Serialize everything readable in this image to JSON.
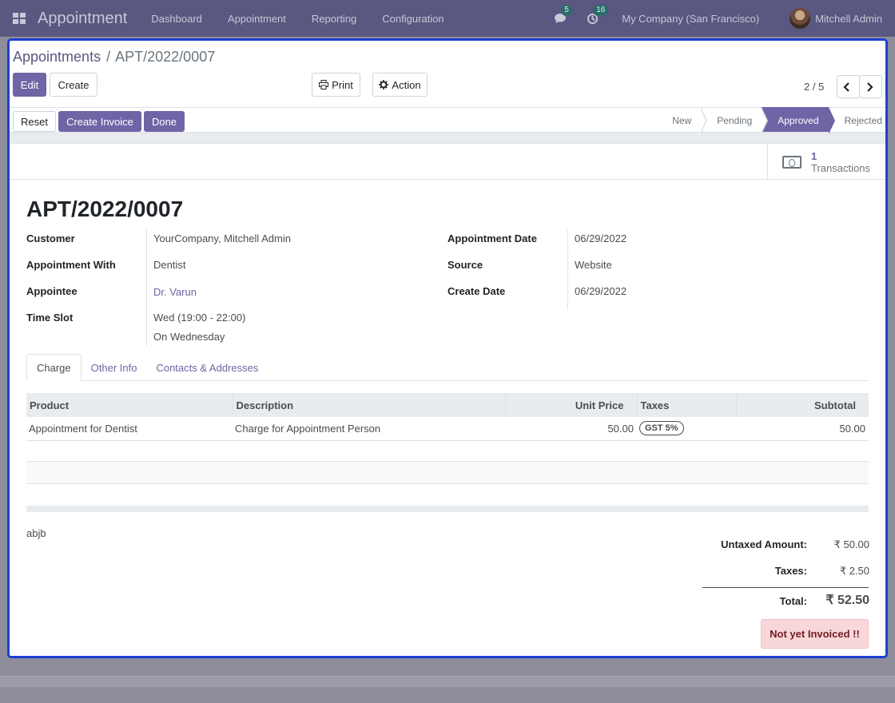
{
  "navbar": {
    "app_title": "Appointment",
    "menu": [
      "Dashboard",
      "Appointment",
      "Reporting",
      "Configuration"
    ],
    "messages_count": "5",
    "activities_count": "16",
    "company": "My Company (San Francisco)",
    "user": "Mitchell Admin"
  },
  "breadcrumb": {
    "parent": "Appointments",
    "separator": "/",
    "current": "APT/2022/0007"
  },
  "control": {
    "edit_label": "Edit",
    "create_label": "Create",
    "print_label": "Print",
    "action_label": "Action",
    "pager_value": "2 / 5"
  },
  "header_buttons": {
    "reset": "Reset",
    "create_invoice": "Create Invoice",
    "done": "Done"
  },
  "statusbar": {
    "stages": [
      "New",
      "Pending",
      "Approved",
      "Rejected"
    ],
    "active": "Approved"
  },
  "smart_button": {
    "value": "1",
    "label": "Transactions"
  },
  "record": {
    "name": "APT/2022/0007",
    "left_fields": [
      {
        "label": "Customer",
        "value": "YourCompany, Mitchell Admin"
      },
      {
        "label": "Appointment With",
        "value": "Dentist"
      },
      {
        "label": "Appointee",
        "value": "Dr. Varun"
      },
      {
        "label": "Time Slot",
        "value": "Wed (19:00 - 22:00)",
        "value2": "On Wednesday"
      }
    ],
    "right_fields": [
      {
        "label": "Appointment Date",
        "value": "06/29/2022"
      },
      {
        "label": "Source",
        "value": "Website"
      },
      {
        "label": "Create Date",
        "value": "06/29/2022"
      }
    ]
  },
  "tabs": [
    "Charge",
    "Other Info",
    "Contacts & Addresses"
  ],
  "lines": {
    "headers": [
      "Product",
      "Description",
      "Unit Price",
      "Taxes",
      "Subtotal"
    ],
    "rows": [
      {
        "product": "Appointment for Dentist",
        "description": "Charge for Appointment Person",
        "unit_price": "50.00",
        "tax": "GST 5%",
        "subtotal": "50.00"
      }
    ]
  },
  "note": "abjb",
  "totals": {
    "untaxed_label": "Untaxed Amount:",
    "untaxed_value": "₹ 50.00",
    "taxes_label": "Taxes:",
    "taxes_value": "₹ 2.50",
    "total_label": "Total:",
    "total_value": "₹ 52.50"
  },
  "invoice_status": "Not yet Invoiced !!",
  "colors": {
    "navbar": "#5a5781",
    "primary": "#6f64a5",
    "focus_border": "#1f3fd1",
    "warning_bg": "#f8d7da"
  }
}
